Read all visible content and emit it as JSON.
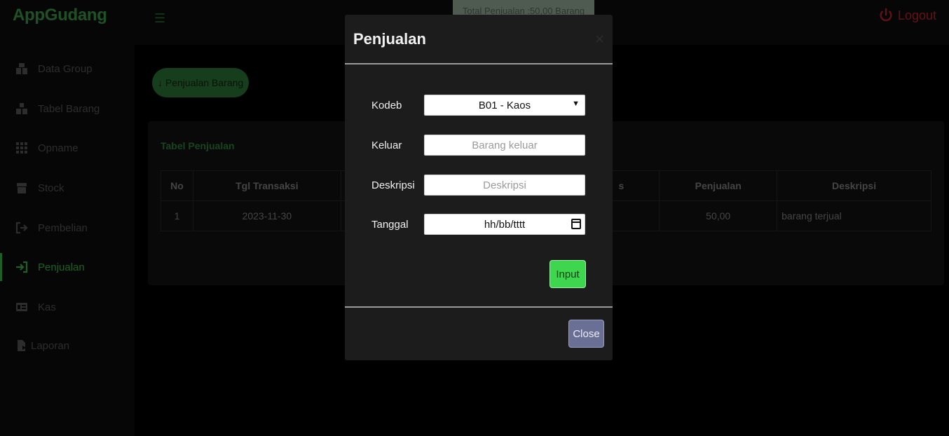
{
  "app": {
    "brand": "AppGudang",
    "menu_icon": "☰",
    "total_chip": "Total Penjualan :50,00 Barang",
    "logout_label": "Logout"
  },
  "sidebar": {
    "items": [
      {
        "label": "Data Group",
        "icon": "group-icon"
      },
      {
        "label": "Tabel Barang",
        "icon": "boxes-icon"
      },
      {
        "label": "Opname",
        "icon": "grid-icon"
      },
      {
        "label": "Stock",
        "icon": "box-icon"
      },
      {
        "label": "Pembelian",
        "icon": "sign-out-icon"
      },
      {
        "label": "Penjualan",
        "icon": "sign-in-icon",
        "active": true
      },
      {
        "label": "Kas",
        "icon": "money-icon"
      },
      {
        "label": "Laporan",
        "icon": "report-icon"
      }
    ]
  },
  "main": {
    "penjualan_button": "↓ Penjualan Barang",
    "table_title": "Tabel Penjualan",
    "columns": [
      "No",
      "Tgl Transaksi",
      "",
      "s",
      "Penjualan",
      "Deskripsi"
    ],
    "rows": [
      {
        "no": "1",
        "tgl": "2023-11-30",
        "penjualan": "50,00",
        "deskripsi": "barang terjual"
      }
    ]
  },
  "modal": {
    "title": "Penjualan",
    "close_x": "×",
    "fields": {
      "kodeb_label": "Kodeb",
      "kodeb_value": "B01 - Kaos",
      "keluar_label": "Keluar",
      "keluar_placeholder": "Barang keluar",
      "deskripsi_label": "Deskripsi",
      "deskripsi_placeholder": "Deskripsi",
      "tanggal_label": "Tanggal",
      "tanggal_value": "hh/bb/tttt"
    },
    "input_button": "Input",
    "close_button": "Close"
  },
  "colors": {
    "accent_green": "#39c04b",
    "logout_red": "#c8242c",
    "close_button": "#6a6f96"
  }
}
